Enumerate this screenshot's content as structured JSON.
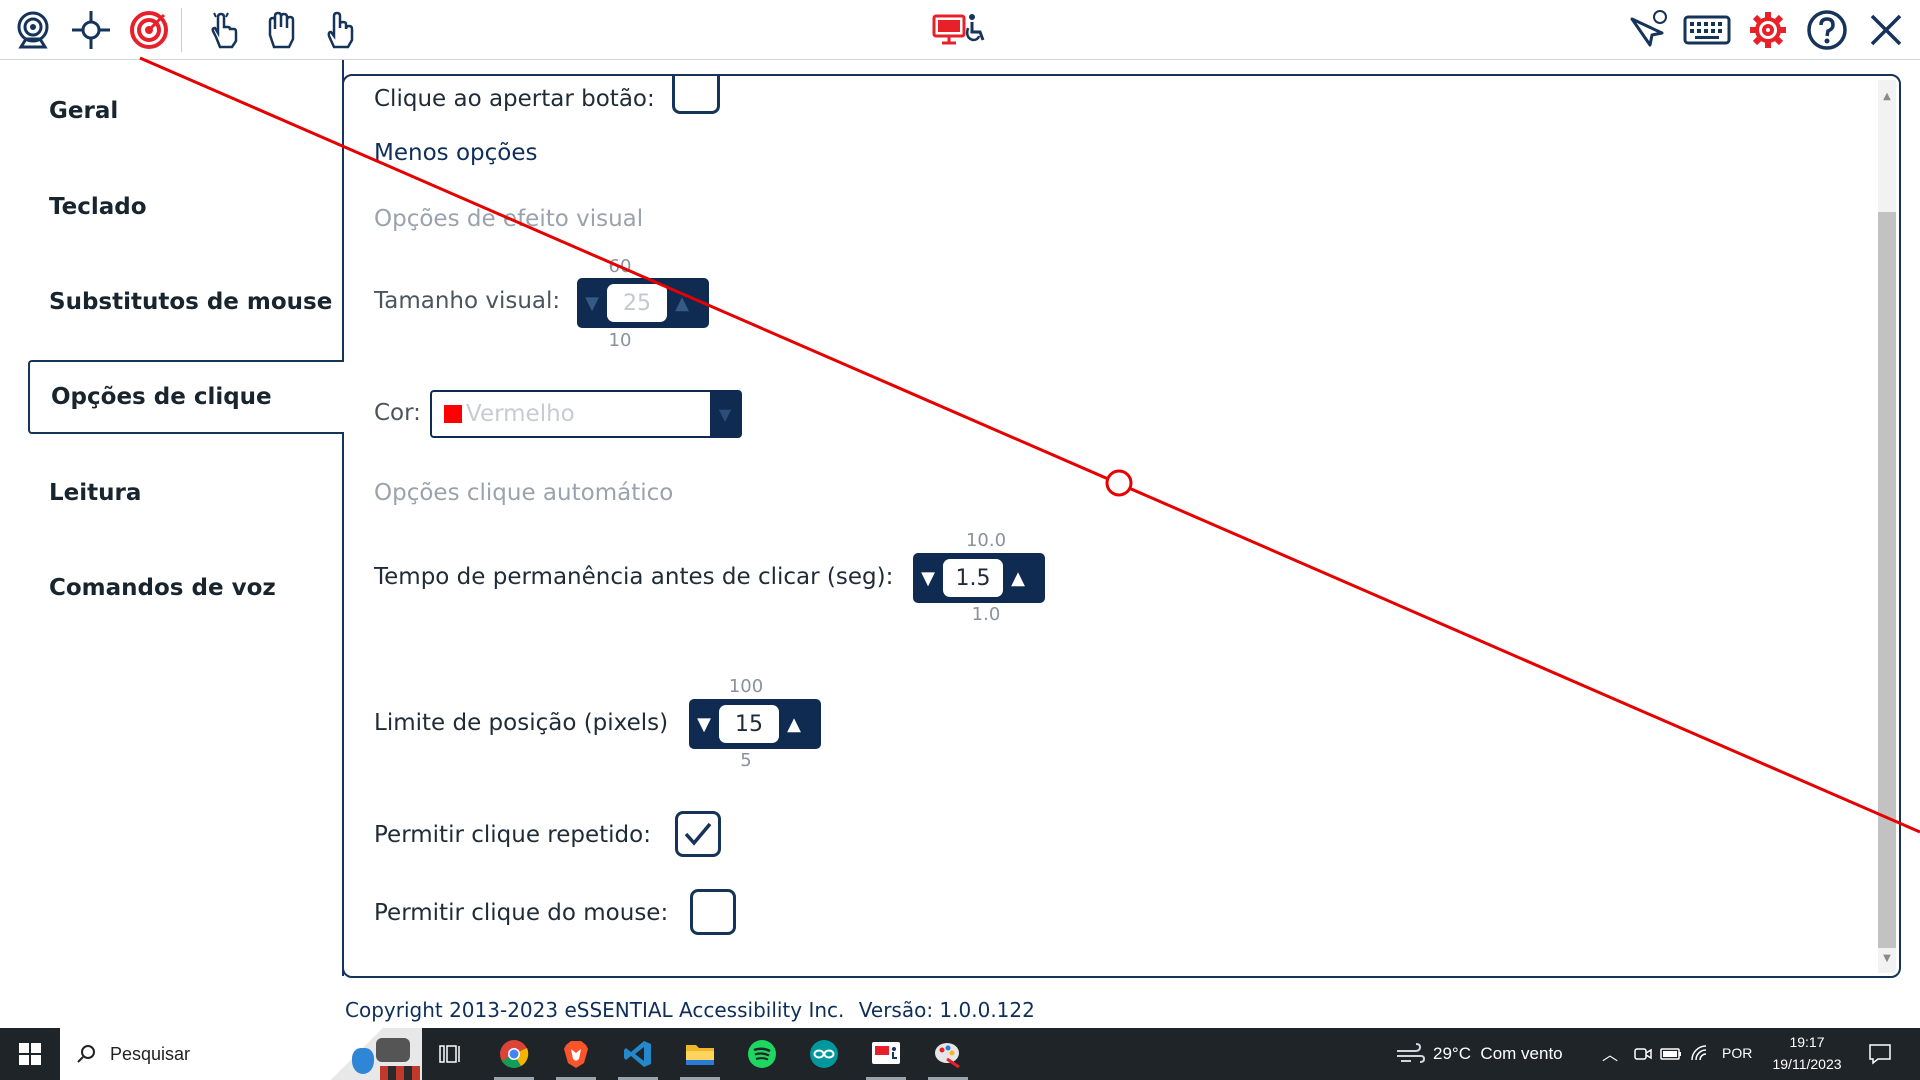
{
  "toolbar": {
    "left_icons": [
      "webcam-icon",
      "crosshair-icon",
      "target-icon",
      "tap-hand-icon",
      "grab-hand-icon",
      "point-hand-icon"
    ],
    "center_icon": "monitor-accessibility-icon",
    "right_icons": [
      "cursor-voice-icon",
      "keyboard-icon",
      "gear-icon",
      "help-icon",
      "close-icon"
    ]
  },
  "sidebar": {
    "items": [
      {
        "label": "Geral"
      },
      {
        "label": "Teclado"
      },
      {
        "label": "Substitutos de mouse"
      },
      {
        "label": "Opções de clique",
        "active": true
      },
      {
        "label": "Leitura"
      },
      {
        "label": "Comandos de voz"
      }
    ]
  },
  "main": {
    "click_on_press_label": "Clique ao apertar botão:",
    "click_on_press_checked": false,
    "less_options_link": "Menos opções",
    "visual_section_title": "Opções de efeito visual",
    "visual_size": {
      "label": "Tamanho visual:",
      "value": "25",
      "max": "60",
      "min": "10"
    },
    "color": {
      "label": "Cor:",
      "value": "Vermelho",
      "swatch": "#ff0000"
    },
    "auto_section_title": "Opções clique automático",
    "dwell": {
      "label": "Tempo de permanência antes de clicar (seg):",
      "value": "1.5",
      "max": "10.0",
      "min": "1.0"
    },
    "position_limit": {
      "label": "Limite de posição (pixels)",
      "value": "15",
      "max": "100",
      "min": "5"
    },
    "repeat_click": {
      "label": "Permitir clique repetido:",
      "checked": true
    },
    "mouse_click": {
      "label": "Permitir clique do mouse:",
      "checked": false
    }
  },
  "footer": {
    "copyright": "Copyright 2013-2023 eSSENTIAL Accessibility Inc.",
    "version": "Versão: 1.0.0.122"
  },
  "taskbar": {
    "search_placeholder": "Pesquisar",
    "apps": [
      "task-view-icon",
      "chrome-icon",
      "brave-icon",
      "vscode-icon",
      "file-explorer-icon",
      "spotify-icon",
      "arduino-icon",
      "accessibility-app-icon",
      "paint-app-icon"
    ],
    "weather": "29°C  Com vento",
    "language": "POR",
    "time": "19:17",
    "date": "19/11/2023"
  },
  "colors": {
    "navy": "#0f2b52",
    "accent_red": "#e8202a",
    "tracking_line": "#e60000"
  }
}
